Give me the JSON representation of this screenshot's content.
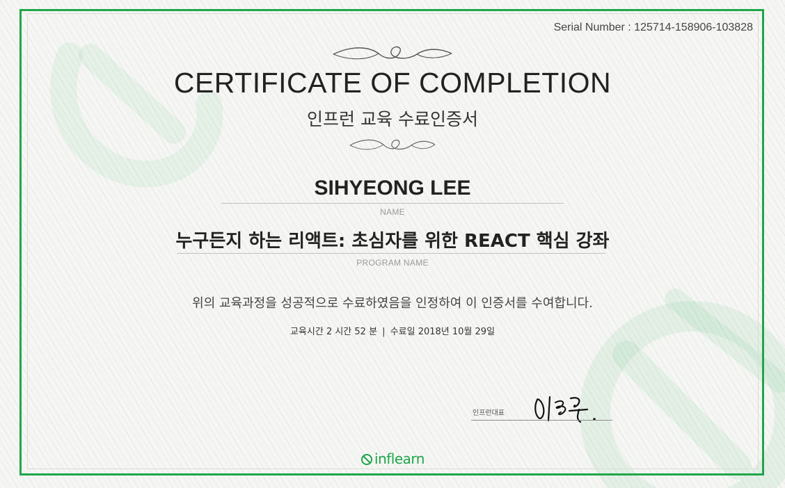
{
  "serial": {
    "label": "Serial Number : 125714-158906-103828"
  },
  "certificate": {
    "title_en": "CERTIFICATE OF COMPLETION",
    "title_ko": "인프런 교육 수료인증서",
    "recipient_name": "SIHYEONG LEE",
    "name_caption": "NAME",
    "program_name": "누구든지 하는 리액트: 초심자를 위한 REACT 핵심 강좌",
    "program_caption": "PROGRAM NAME",
    "statement": "위의 교육과정을 성공적으로 수료하였음을 인정하여 이 인증서를 수여합니다.",
    "details": {
      "duration": "교육시간 2 시간 52 분",
      "separator": "|",
      "completion_date": "수료일 2018년 10월 29일"
    }
  },
  "signature": {
    "label": "인프런대표",
    "handwriting": "이형주."
  },
  "logo": {
    "text": "inflearn"
  },
  "colors": {
    "brand_green": "#1fa64a",
    "text_dark": "#222222",
    "caption_gray": "#9a9a9a"
  },
  "icons": {
    "logo_mark": "inflearn-logo-icon",
    "watermark": "inflearn-watermark-icon"
  }
}
